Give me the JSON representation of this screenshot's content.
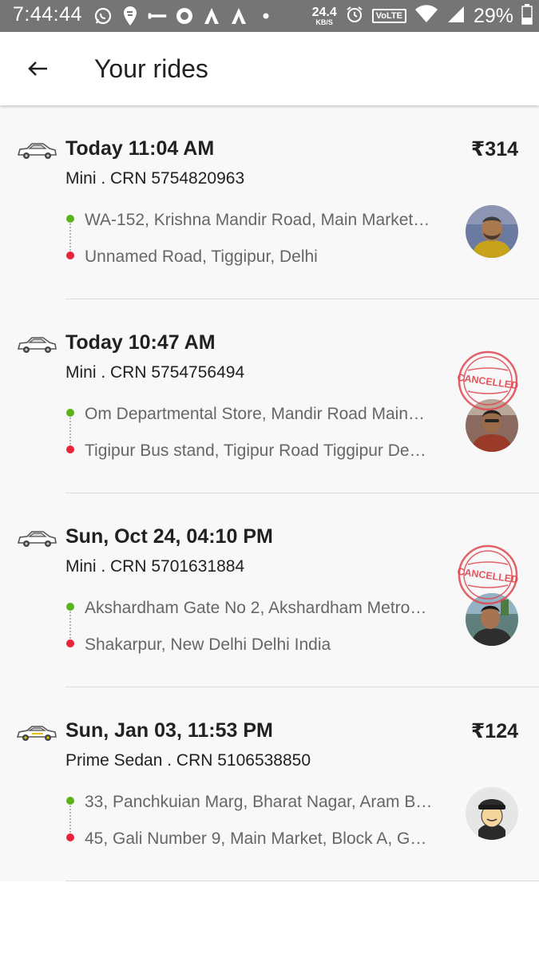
{
  "status_bar": {
    "time": "7:44:44",
    "net_speed": "24.4",
    "net_speed_unit": "KB/S",
    "volte": "VoLTE",
    "battery": "29%",
    "left_icons": [
      "whatsapp-icon",
      "swiggy-icon",
      "key-icon",
      "circle-app-icon",
      "a-icon",
      "a-icon",
      "dot-icon"
    ],
    "right_icons": [
      "alarm-icon",
      "wifi-icon",
      "signal-icon",
      "battery-icon"
    ]
  },
  "header": {
    "back_icon": "arrow-left-icon",
    "title": "Your rides"
  },
  "rides": [
    {
      "time": "Today 11:04 AM",
      "sub": "Mini . CRN 5754820963",
      "fare": "₹314",
      "pickup": "WA-152, Krishna Mandir Road, Main Market…",
      "drop": "Unnamed Road, Tiggipur, Delhi",
      "cancelled": false,
      "avatar": "driver-photo"
    },
    {
      "time": "Today 10:47 AM",
      "sub": "Mini . CRN 5754756494",
      "fare": "",
      "pickup": "Om Departmental Store, Mandir Road Main…",
      "drop": "Tigipur Bus stand, Tigipur Road Tiggipur De…",
      "cancelled": true,
      "stamp_text": "CANCELLED",
      "avatar": "driver-photo"
    },
    {
      "time": "Sun, Oct 24, 04:10 PM",
      "sub": "Mini . CRN 5701631884",
      "fare": "",
      "pickup": "Akshardham Gate No 2, Akshardham Metro…",
      "drop": "Shakarpur, New Delhi Delhi India",
      "cancelled": true,
      "stamp_text": "CANCELLED",
      "avatar": "driver-photo"
    },
    {
      "time": "Sun, Jan 03, 11:53 PM",
      "sub": "Prime Sedan . CRN 5106538850",
      "fare": "₹124",
      "pickup": "33, Panchkuian Marg, Bharat Nagar, Aram B…",
      "drop": "45, Gali Number 9, Main Market, Block A, G…",
      "cancelled": false,
      "avatar": "driver-placeholder-icon"
    }
  ],
  "colors": {
    "pickup_dot": "#5cb31a",
    "drop_dot": "#e8243a",
    "stamp": "#e0454f",
    "status_bar": "#757575"
  }
}
